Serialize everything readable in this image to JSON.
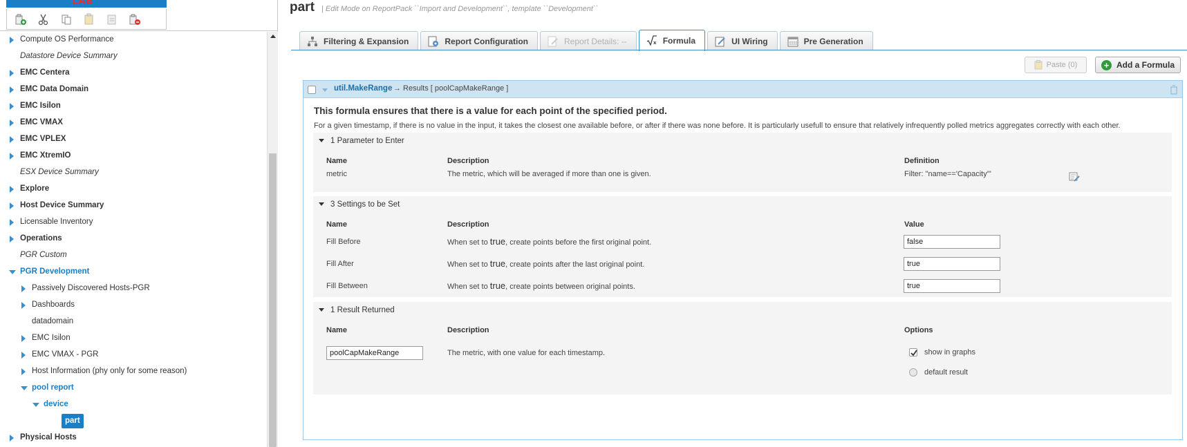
{
  "logo": {
    "text": "LAB"
  },
  "left_toolbar": {
    "buttons": [
      "add-node-icon",
      "cut-icon",
      "copy-icon",
      "paste-icon",
      "paste-special-icon",
      "delete-node-icon"
    ]
  },
  "tree": {
    "items": [
      {
        "label": "Compute OS Performance",
        "style": "normal",
        "arrow": "right",
        "indent": 0
      },
      {
        "label": "Datastore Device Summary",
        "style": "italic",
        "arrow": "none",
        "indent": 0
      },
      {
        "label": "EMC Centera",
        "style": "bold",
        "arrow": "right",
        "indent": 0
      },
      {
        "label": "EMC Data Domain",
        "style": "bold",
        "arrow": "right",
        "indent": 0
      },
      {
        "label": "EMC Isilon",
        "style": "bold",
        "arrow": "right",
        "indent": 0
      },
      {
        "label": "EMC VMAX",
        "style": "bold",
        "arrow": "right",
        "indent": 0
      },
      {
        "label": "EMC VPLEX",
        "style": "bold",
        "arrow": "right",
        "indent": 0
      },
      {
        "label": "EMC XtremIO",
        "style": "bold",
        "arrow": "right",
        "indent": 0
      },
      {
        "label": "ESX Device Summary",
        "style": "italic",
        "arrow": "none",
        "indent": 0
      },
      {
        "label": "Explore",
        "style": "bold",
        "arrow": "right",
        "indent": 0
      },
      {
        "label": "Host Device Summary",
        "style": "bold",
        "arrow": "right",
        "indent": 0
      },
      {
        "label": "Licensable Inventory",
        "style": "normal",
        "arrow": "right",
        "indent": 0
      },
      {
        "label": "Operations",
        "style": "bold",
        "arrow": "right",
        "indent": 0
      },
      {
        "label": "PGR Custom",
        "style": "italic",
        "arrow": "none",
        "indent": 0
      },
      {
        "label": "PGR Development",
        "style": "active",
        "arrow": "down",
        "indent": 0
      },
      {
        "label": "Passively Discovered Hosts-PGR",
        "style": "normal",
        "arrow": "right",
        "indent": 1
      },
      {
        "label": "Dashboards",
        "style": "normal",
        "arrow": "right",
        "indent": 1
      },
      {
        "label": "datadomain",
        "style": "normal",
        "arrow": "none",
        "indent": 1
      },
      {
        "label": "EMC Isilon",
        "style": "normal",
        "arrow": "right",
        "indent": 1
      },
      {
        "label": "EMC VMAX - PGR",
        "style": "normal",
        "arrow": "right",
        "indent": 1
      },
      {
        "label": "Host Information (phy only for some reason)",
        "style": "normal",
        "arrow": "right",
        "indent": 1
      },
      {
        "label": "pool report",
        "style": "active",
        "arrow": "down",
        "indent": 1
      },
      {
        "label": "device",
        "style": "active",
        "arrow": "down",
        "indent": 2
      },
      {
        "label": "part",
        "style": "selected",
        "arrow": "none",
        "indent": 3
      },
      {
        "label": "Physical Hosts",
        "style": "bold",
        "arrow": "right",
        "indent": 0
      }
    ]
  },
  "header": {
    "title": "part",
    "subtitle": "| Edit Mode on ReportPack ``Import and Development``, template ``Development``"
  },
  "tabs": [
    {
      "label": "Filtering & Expansion",
      "icon": "hierarchy-icon",
      "state": "normal"
    },
    {
      "label": "Report Configuration",
      "icon": "report-config-icon",
      "state": "normal"
    },
    {
      "label": "Report Details: --",
      "icon": "report-details-icon",
      "state": "disabled"
    },
    {
      "label": "Formula",
      "icon": "formula-icon",
      "state": "active"
    },
    {
      "label": "UI Wiring",
      "icon": "ui-wiring-icon",
      "state": "normal"
    },
    {
      "label": "Pre Generation",
      "icon": "calendar-icon",
      "state": "normal"
    }
  ],
  "actions": {
    "paste_label": "Paste (0)",
    "add_formula_label": "Add a Formula"
  },
  "formula": {
    "name": "util.MakeRange",
    "results": "→ Results [ poolCapMakeRange ]",
    "description_title": "This formula ensures that there is a value for each point of the specified period.",
    "description": "For a given timestamp, if there is no value in the input, it takes the closest one available before, or after if there was none before. It is particularly usefull to ensure that relatively infrequently polled metrics aggregates correctly with each other.",
    "parameters": {
      "heading": "1 Parameter to Enter",
      "columns": {
        "name": "Name",
        "description": "Description",
        "definition": "Definition"
      },
      "rows": [
        {
          "name": "metric",
          "description": "The metric, which will be averaged if more than one is given.",
          "definition": "Filter: \"name=='Capacity'\""
        }
      ]
    },
    "settings": {
      "heading": "3 Settings to be Set",
      "columns": {
        "name": "Name",
        "description": "Description",
        "value": "Value"
      },
      "rows": [
        {
          "name": "Fill Before",
          "desc_pre": "When set to ",
          "keyword": "true",
          "desc_post": ", create points before the first original point.",
          "value": "false"
        },
        {
          "name": "Fill After",
          "desc_pre": "When set to ",
          "keyword": "true",
          "desc_post": ", create points after the last original point.",
          "value": "true"
        },
        {
          "name": "Fill Between",
          "desc_pre": "When set to ",
          "keyword": "true",
          "desc_post": ", create points between original points.",
          "value": "true"
        }
      ]
    },
    "results_section": {
      "heading": "1 Result Returned",
      "columns": {
        "name": "Name",
        "description": "Description",
        "options": "Options"
      },
      "row": {
        "name": "poolCapMakeRange",
        "description": "The metric, with one value for each timestamp.",
        "show_in_graphs_label": "show in graphs",
        "show_in_graphs_checked": true,
        "default_result_label": "default result",
        "default_result_selected": false
      }
    }
  },
  "colors": {
    "accent": "#1a7fc4",
    "header_bg": "#cfe4f2",
    "section_bg": "#f4f4f4"
  }
}
